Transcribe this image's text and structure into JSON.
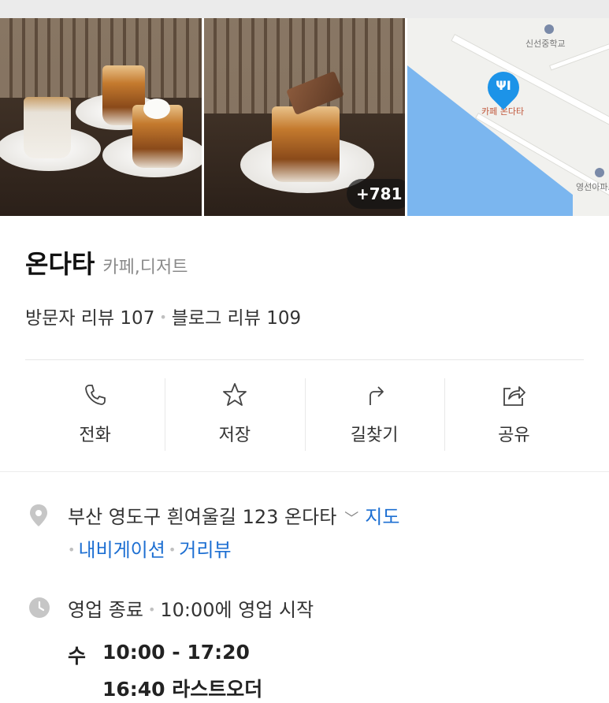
{
  "gallery": {
    "more_count": "+781",
    "map": {
      "label_school": "신선중학교",
      "label_place": "카페 온다타",
      "label_apartment": "영선아파트"
    }
  },
  "place": {
    "name": "온다타",
    "category": "카페,디저트"
  },
  "reviews": {
    "visitor": "방문자 리뷰 107",
    "blog": "블로그 리뷰 109"
  },
  "actions": [
    {
      "label": "전화",
      "icon": "phone-icon"
    },
    {
      "label": "저장",
      "icon": "star-icon"
    },
    {
      "label": "길찾기",
      "icon": "directions-icon"
    },
    {
      "label": "공유",
      "icon": "share-icon"
    }
  ],
  "address": {
    "text": "부산 영도구 흰여울길 123 온다타",
    "map_link": "지도",
    "navigation_link": "내비게이션",
    "street_view_link": "거리뷰"
  },
  "hours": {
    "status": "영업 종료",
    "next": "10:00에 영업 시작",
    "day": "수",
    "time": "10:00 - 17:20",
    "last_order": "16:40 라스트오더"
  },
  "colors": {
    "accent": "#1d6fd2",
    "pin": "#1c93e8"
  }
}
